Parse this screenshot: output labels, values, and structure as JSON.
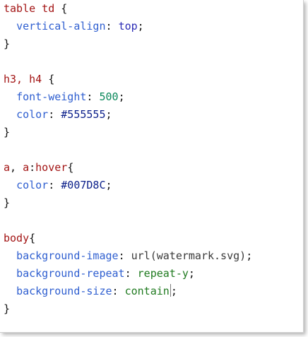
{
  "editor": {
    "lines": [
      [
        {
          "t": "sel",
          "v": "table td"
        },
        {
          "t": "punct",
          "v": " {"
        }
      ],
      [
        {
          "t": "punct",
          "v": "  "
        },
        {
          "t": "prop",
          "v": "vertical-align"
        },
        {
          "t": "punct",
          "v": ": "
        },
        {
          "t": "kw",
          "v": "top"
        },
        {
          "t": "punct",
          "v": ";"
        }
      ],
      [
        {
          "t": "punct",
          "v": "}"
        }
      ],
      [],
      [
        {
          "t": "sel",
          "v": "h3, h4"
        },
        {
          "t": "punct",
          "v": " {"
        }
      ],
      [
        {
          "t": "punct",
          "v": "  "
        },
        {
          "t": "prop",
          "v": "font-weight"
        },
        {
          "t": "punct",
          "v": ": "
        },
        {
          "t": "num",
          "v": "500"
        },
        {
          "t": "punct",
          "v": ";"
        }
      ],
      [
        {
          "t": "punct",
          "v": "  "
        },
        {
          "t": "prop",
          "v": "color"
        },
        {
          "t": "punct",
          "v": ": "
        },
        {
          "t": "hex",
          "v": "#555555"
        },
        {
          "t": "punct",
          "v": ";"
        }
      ],
      [
        {
          "t": "punct",
          "v": "}"
        }
      ],
      [],
      [
        {
          "t": "sel",
          "v": "a"
        },
        {
          "t": "punct",
          "v": ", "
        },
        {
          "t": "sel",
          "v": "a"
        },
        {
          "t": "punct",
          "v": ":"
        },
        {
          "t": "sel",
          "v": "hover"
        },
        {
          "t": "punct",
          "v": "{"
        }
      ],
      [
        {
          "t": "punct",
          "v": "  "
        },
        {
          "t": "prop",
          "v": "color"
        },
        {
          "t": "punct",
          "v": ": "
        },
        {
          "t": "hex",
          "v": "#007D8C"
        },
        {
          "t": "punct",
          "v": ";"
        }
      ],
      [
        {
          "t": "punct",
          "v": "}"
        }
      ],
      [],
      [
        {
          "t": "sel",
          "v": "body"
        },
        {
          "t": "punct",
          "v": "{"
        }
      ],
      [
        {
          "t": "punct",
          "v": "  "
        },
        {
          "t": "prop",
          "v": "background-image"
        },
        {
          "t": "punct",
          "v": ": "
        },
        {
          "t": "fn",
          "v": "url(watermark.svg)"
        },
        {
          "t": "punct",
          "v": ";"
        }
      ],
      [
        {
          "t": "punct",
          "v": "  "
        },
        {
          "t": "prop",
          "v": "background-repeat"
        },
        {
          "t": "punct",
          "v": ": "
        },
        {
          "t": "str",
          "v": "repeat-y"
        },
        {
          "t": "punct",
          "v": ";"
        }
      ],
      [
        {
          "t": "punct",
          "v": "  "
        },
        {
          "t": "prop",
          "v": "background-size"
        },
        {
          "t": "punct",
          "v": ": "
        },
        {
          "t": "str",
          "v": "contain"
        },
        {
          "t": "cursor",
          "v": ""
        },
        {
          "t": "punct",
          "v": ";"
        }
      ],
      [
        {
          "t": "punct",
          "v": "}"
        }
      ]
    ]
  },
  "colors": {
    "selector": "#a31515",
    "property": "#2f5fd0",
    "number": "#09885a",
    "hex_value": "#0b1f8a",
    "keyword": "#2b2bb5",
    "string_value": "#1f7a1f"
  }
}
